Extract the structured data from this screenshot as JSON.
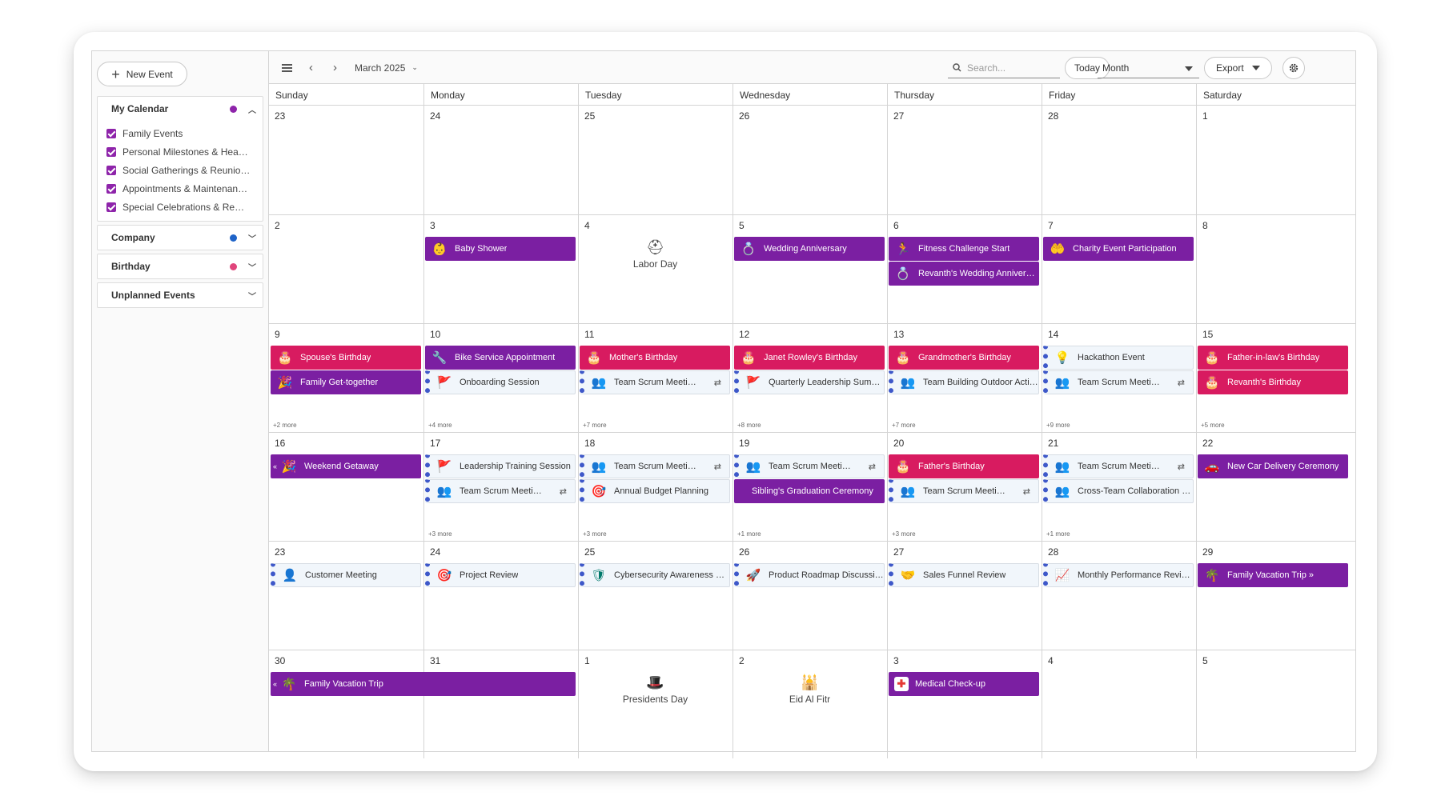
{
  "sidebar": {
    "new_event_label": "New Event",
    "groups": [
      {
        "title": "My Calendar",
        "color": "#8e24aa",
        "expanded": true,
        "items": [
          "Family Events",
          "Personal Milestones & Hea…",
          "Social Gatherings & Reunio…",
          "Appointments & Maintenan…",
          "Special Celebrations & Re…"
        ]
      },
      {
        "title": "Company",
        "color": "#1e63c8",
        "expanded": false
      },
      {
        "title": "Birthday",
        "color": "#e0457b",
        "expanded": false
      },
      {
        "title": "Unplanned Events",
        "expanded": false
      }
    ]
  },
  "toolbar": {
    "date_label": "March 2025",
    "search_placeholder": "Search...",
    "today_label": "Today",
    "view_label": "Month",
    "export_label": "Export"
  },
  "day_headers": [
    "Sunday",
    "Monday",
    "Tuesday",
    "Wednesday",
    "Thursday",
    "Friday",
    "Saturday"
  ],
  "weeks": [
    {
      "days": [
        "23",
        "24",
        "25",
        "26",
        "27",
        "28",
        "1"
      ],
      "events": [],
      "more": [],
      "holidays": []
    },
    {
      "days": [
        "2",
        "3",
        "4",
        "5",
        "6",
        "7",
        "8"
      ],
      "events": [
        {
          "col": 1,
          "span": 1,
          "row": 0,
          "style": "purple",
          "icon": "baby-icon",
          "label": "Baby Shower"
        },
        {
          "col": 3,
          "span": 1,
          "row": 0,
          "style": "purple",
          "icon": "rings-icon",
          "label": "Wedding Anniversary"
        },
        {
          "col": 4,
          "span": 1,
          "row": 0,
          "style": "purple",
          "icon": "runner-icon",
          "label": "Fitness Challenge Start"
        },
        {
          "col": 4,
          "span": 1,
          "row": 1,
          "style": "purple",
          "icon": "rings-icon",
          "label": "Revanth's Wedding Anniversary"
        },
        {
          "col": 5,
          "span": 1,
          "row": 0,
          "style": "purple",
          "icon": "heart-hands-icon",
          "label": "Charity Event Participation"
        }
      ],
      "more": [],
      "holidays": [
        {
          "col": 2,
          "icon": "hard-hat-icon",
          "label": "Labor Day"
        }
      ]
    },
    {
      "days": [
        "9",
        "10",
        "11",
        "12",
        "13",
        "14",
        "15"
      ],
      "events": [
        {
          "col": 0,
          "span": 1,
          "row": 0,
          "style": "pink",
          "icon": "cake-icon",
          "label": "Spouse's Birthday"
        },
        {
          "col": 0,
          "span": 1,
          "row": 1,
          "style": "purple",
          "icon": "party-popper-icon",
          "label": "Family Get-together"
        },
        {
          "col": 1,
          "span": 1,
          "row": 0,
          "style": "purple",
          "icon": "wrench-icon",
          "label": "Bike Service Appointment"
        },
        {
          "col": 1,
          "span": 1,
          "row": 1,
          "style": "light",
          "icon": "flag-icon",
          "label": "Onboarding Session"
        },
        {
          "col": 2,
          "span": 1,
          "row": 0,
          "style": "pink",
          "icon": "cake-icon",
          "label": "Mother's Birthday"
        },
        {
          "col": 2,
          "span": 1,
          "row": 1,
          "style": "light",
          "icon": "team-icon",
          "label": "Team Scrum Meeti…",
          "recurring": true
        },
        {
          "col": 3,
          "span": 1,
          "row": 0,
          "style": "pink",
          "icon": "cake-icon",
          "label": "Janet Rowley's Birthday"
        },
        {
          "col": 3,
          "span": 1,
          "row": 1,
          "style": "light",
          "icon": "flag-icon",
          "label": "Quarterly Leadership Sum…"
        },
        {
          "col": 4,
          "span": 1,
          "row": 0,
          "style": "pink",
          "icon": "cake-icon",
          "label": "Grandmother's Birthday"
        },
        {
          "col": 4,
          "span": 1,
          "row": 1,
          "style": "light",
          "icon": "team-icon",
          "label": "Team Building Outdoor Acti…"
        },
        {
          "col": 5,
          "span": 1,
          "row": 0,
          "style": "light",
          "icon": "lightbulb-icon",
          "label": "Hackathon Event"
        },
        {
          "col": 5,
          "span": 1,
          "row": 1,
          "style": "light",
          "icon": "team-icon",
          "label": "Team Scrum Meeti…",
          "recurring": true
        },
        {
          "col": 6,
          "span": 1,
          "row": 0,
          "style": "pink",
          "icon": "cake-icon",
          "label": "Father-in-law's Birthday"
        },
        {
          "col": 6,
          "span": 1,
          "row": 1,
          "style": "pink",
          "icon": "cake-icon",
          "label": "Revanth's Birthday"
        }
      ],
      "more": [
        "+2 more",
        "+4 more",
        "+7 more",
        "+8 more",
        "+7 more",
        "+9 more",
        "+5 more"
      ],
      "holidays": []
    },
    {
      "days": [
        "16",
        "17",
        "18",
        "19",
        "20",
        "21",
        "22"
      ],
      "events": [
        {
          "col": 0,
          "span": 1,
          "row": 0,
          "style": "purple",
          "icon": "party-popper-icon",
          "label": "Weekend Getaway",
          "continues_left": true
        },
        {
          "col": 1,
          "span": 1,
          "row": 0,
          "style": "light",
          "icon": "flag-icon",
          "label": "Leadership Training Session"
        },
        {
          "col": 1,
          "span": 1,
          "row": 1,
          "style": "light",
          "icon": "team-icon",
          "label": "Team Scrum Meeti…",
          "recurring": true
        },
        {
          "col": 2,
          "span": 1,
          "row": 0,
          "style": "light",
          "icon": "team-icon",
          "label": "Team Scrum Meeti…",
          "recurring": true
        },
        {
          "col": 2,
          "span": 1,
          "row": 1,
          "style": "light",
          "icon": "target-icon",
          "label": "Annual Budget Planning"
        },
        {
          "col": 3,
          "span": 1,
          "row": 0,
          "style": "light",
          "icon": "team-icon",
          "label": "Team Scrum Meeti…",
          "recurring": true
        },
        {
          "col": 3,
          "span": 1,
          "row": 1,
          "style": "purple",
          "icon": "",
          "label": "Sibling's Graduation Ceremony"
        },
        {
          "col": 4,
          "span": 1,
          "row": 0,
          "style": "pink",
          "icon": "cake-icon",
          "label": "Father's Birthday"
        },
        {
          "col": 4,
          "span": 1,
          "row": 1,
          "style": "light",
          "icon": "team-icon",
          "label": "Team Scrum Meeti…",
          "recurring": true
        },
        {
          "col": 5,
          "span": 1,
          "row": 0,
          "style": "light",
          "icon": "team-icon",
          "label": "Team Scrum Meeti…",
          "recurring": true
        },
        {
          "col": 5,
          "span": 1,
          "row": 1,
          "style": "light",
          "icon": "team-icon",
          "label": "Cross-Team Collaboration …"
        },
        {
          "col": 6,
          "span": 1,
          "row": 0,
          "style": "purple",
          "icon": "car-icon",
          "label": "New Car Delivery Ceremony"
        }
      ],
      "more": [
        "",
        "+3 more",
        "+3 more",
        "+1 more",
        "+3 more",
        "+1 more",
        ""
      ],
      "holidays": []
    },
    {
      "days": [
        "23",
        "24",
        "25",
        "26",
        "27",
        "28",
        "29"
      ],
      "events": [
        {
          "col": 0,
          "span": 1,
          "row": 0,
          "style": "light",
          "icon": "person-icon",
          "label": "Customer Meeting"
        },
        {
          "col": 1,
          "span": 1,
          "row": 0,
          "style": "light",
          "icon": "target-icon",
          "label": "Project Review"
        },
        {
          "col": 2,
          "span": 1,
          "row": 0,
          "style": "light",
          "icon": "shield-icon",
          "label": "Cybersecurity Awareness …"
        },
        {
          "col": 3,
          "span": 1,
          "row": 0,
          "style": "light",
          "icon": "rocket-icon",
          "label": "Product Roadmap Discussi…"
        },
        {
          "col": 4,
          "span": 1,
          "row": 0,
          "style": "light",
          "icon": "funnel-icon",
          "label": "Sales Funnel Review"
        },
        {
          "col": 5,
          "span": 1,
          "row": 0,
          "style": "light",
          "icon": "gauge-icon",
          "label": "Monthly Performance Revi…"
        },
        {
          "col": 6,
          "span": 1,
          "row": 0,
          "style": "purple",
          "icon": "palm-tree-icon",
          "label": "Family Vacation Trip »"
        }
      ],
      "more": [],
      "holidays": []
    },
    {
      "days": [
        "30",
        "31",
        "1",
        "2",
        "3",
        "4",
        "5"
      ],
      "events": [
        {
          "col": 0,
          "span": 2,
          "row": 0,
          "style": "purple",
          "icon": "palm-tree-icon",
          "label": "Family Vacation Trip",
          "continues_left": true
        },
        {
          "col": 4,
          "span": 1,
          "row": 0,
          "style": "purple",
          "icon": "medical-icon",
          "label": "Medical Check-up"
        }
      ],
      "more": [],
      "holidays": [
        {
          "col": 2,
          "icon": "top-hat-icon",
          "label": "Presidents Day"
        },
        {
          "col": 3,
          "icon": "mosque-icon",
          "label": "Eid Al Fitr"
        }
      ]
    }
  ]
}
